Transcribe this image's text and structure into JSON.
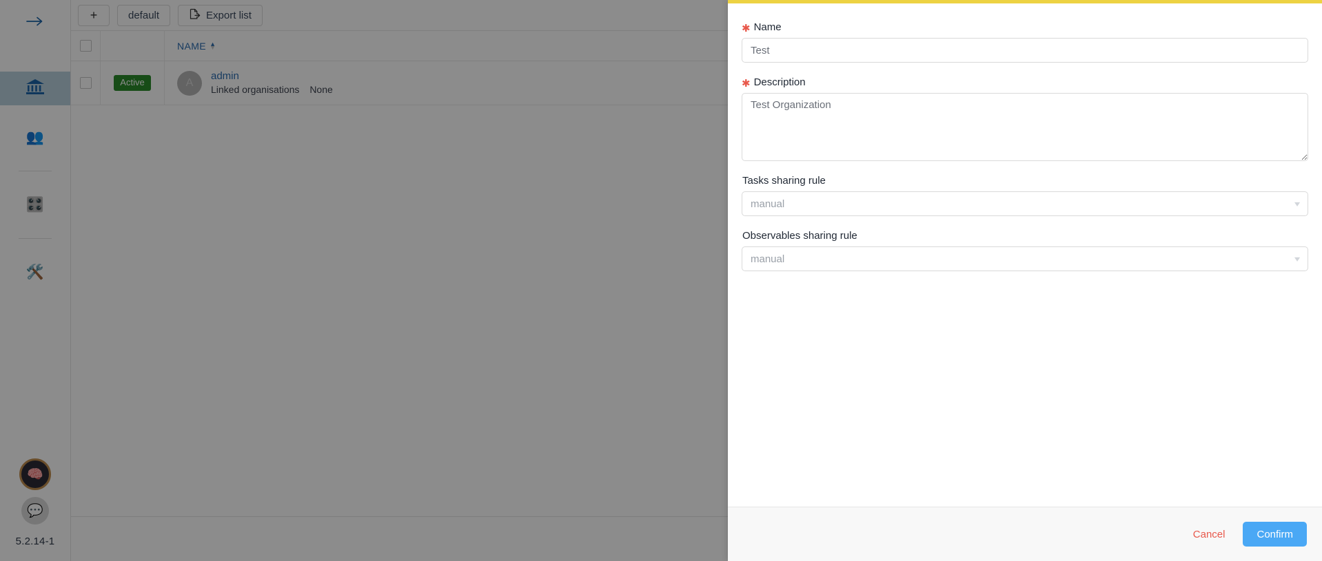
{
  "sidebar": {
    "items": [
      {
        "name": "expand-sidebar",
        "icon": "arrow-right-icon",
        "label": ""
      },
      {
        "name": "organisations",
        "icon": "bank-icon",
        "label": ""
      },
      {
        "name": "users",
        "icon": "people-icon",
        "label": ""
      },
      {
        "name": "platform-settings",
        "icon": "sliders-icon",
        "label": ""
      },
      {
        "name": "admin-tools",
        "icon": "tools-icon",
        "label": ""
      }
    ],
    "brain_icon": "brain-icon",
    "chat_icon": "chat-bubble-icon",
    "version": "5.2.14-1"
  },
  "toolbar": {
    "add_label": "+",
    "default_label": "default",
    "export_label": "Export list",
    "export_icon": "export-file-icon"
  },
  "table": {
    "columns": [
      {
        "key": "select",
        "label": ""
      },
      {
        "key": "status",
        "label": ""
      },
      {
        "key": "name",
        "label": "NAME",
        "sorted": "asc"
      }
    ],
    "rows": [
      {
        "status": "Active",
        "avatar_initial": "A",
        "name": "admin",
        "sub_label": "Linked organisations",
        "sub_value": "None"
      }
    ]
  },
  "drawer": {
    "accent_color": "#edd243",
    "fields": {
      "name": {
        "label": "Name",
        "required": true,
        "value": "Test",
        "placeholder": "Test"
      },
      "description": {
        "label": "Description",
        "required": true,
        "value": "Test Organization",
        "placeholder": "Test Organization"
      },
      "tasks_sharing_rule": {
        "label": "Tasks sharing rule",
        "required": false,
        "value": "manual",
        "chevron": "chevron-down-icon"
      },
      "observables_sharing_rule": {
        "label": "Observables sharing rule",
        "required": false,
        "value": "manual",
        "chevron": "chevron-down-icon"
      }
    },
    "footer": {
      "cancel_label": "Cancel",
      "confirm_label": "Confirm",
      "cancel_color": "#e8584b",
      "confirm_color": "#4aa8f5"
    }
  }
}
